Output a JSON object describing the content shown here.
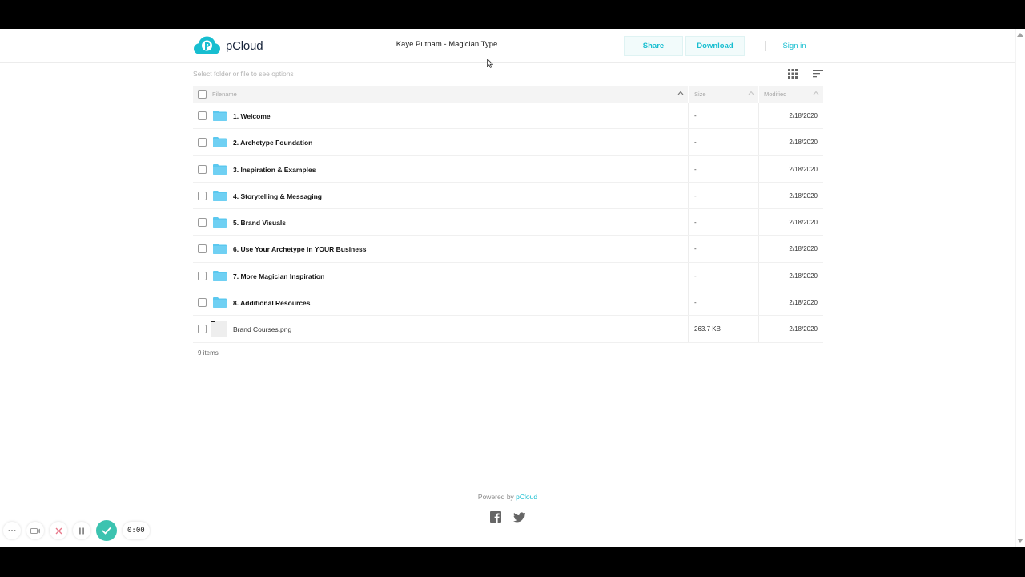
{
  "header": {
    "brand": "pCloud",
    "title": "Kaye Putnam - Magician Type",
    "share_label": "Share",
    "download_label": "Download",
    "signin_label": "Sign in"
  },
  "toolbar": {
    "hint": "Select folder or file to see options"
  },
  "table": {
    "columns": {
      "name": "Filename",
      "size": "Size",
      "modified": "Modified"
    },
    "rows": [
      {
        "name": "1. Welcome",
        "size": "-",
        "modified": "2/18/2020",
        "type": "folder"
      },
      {
        "name": "2. Archetype Foundation",
        "size": "-",
        "modified": "2/18/2020",
        "type": "folder"
      },
      {
        "name": "3. Inspiration & Examples",
        "size": "-",
        "modified": "2/18/2020",
        "type": "folder"
      },
      {
        "name": "4. Storytelling & Messaging",
        "size": "-",
        "modified": "2/18/2020",
        "type": "folder"
      },
      {
        "name": "5. Brand Visuals",
        "size": "-",
        "modified": "2/18/2020",
        "type": "folder"
      },
      {
        "name": "6. Use Your Archetype in YOUR Business",
        "size": "-",
        "modified": "2/18/2020",
        "type": "folder"
      },
      {
        "name": "7. More Magician Inspiration",
        "size": "-",
        "modified": "2/18/2020",
        "type": "folder"
      },
      {
        "name": "8. Additional Resources",
        "size": "-",
        "modified": "2/18/2020",
        "type": "folder"
      },
      {
        "name": "Brand Courses.png",
        "size": "263.7 KB",
        "modified": "2/18/2020",
        "type": "file"
      }
    ],
    "items_count": "9 items"
  },
  "footer": {
    "powered_prefix": "Powered by ",
    "powered_link": "pCloud"
  },
  "recorder": {
    "time": "0:00"
  },
  "colors": {
    "accent": "#17bed0",
    "folder": "#5bc8ef",
    "recorder_check": "#3cc3b0"
  }
}
